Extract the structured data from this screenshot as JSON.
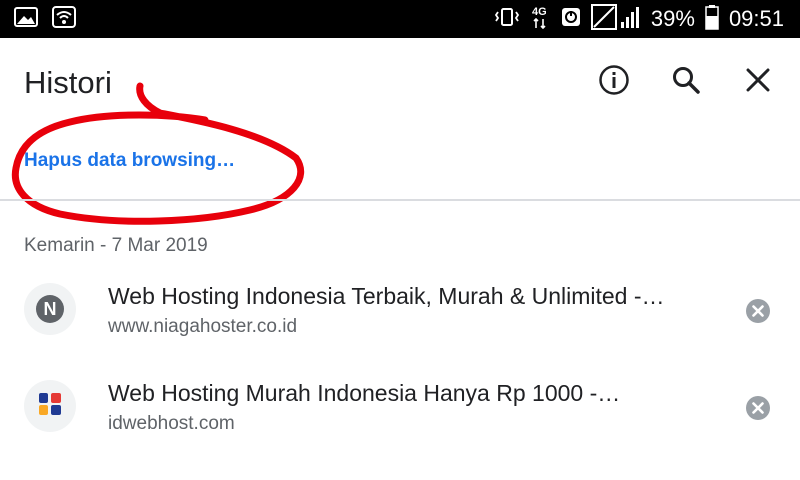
{
  "status_bar": {
    "battery_percent": "39%",
    "time": "09:51",
    "network_label": "4G",
    "icons": [
      "image-icon",
      "wifi-icon",
      "vibrate-icon",
      "network-4g-icon",
      "data-saver-icon",
      "signal-icon",
      "battery-icon"
    ]
  },
  "header": {
    "title": "Histori",
    "actions": [
      "info-icon",
      "search-icon",
      "close-icon"
    ]
  },
  "clear_browsing_label": "Hapus data browsing…",
  "history": {
    "date_header": "Kemarin - 7 Mar 2019",
    "items": [
      {
        "title": "Web Hosting Indonesia Terbaik, Murah & Unlimited -…",
        "url": "www.niagahoster.co.id",
        "favicon_letter": "N"
      },
      {
        "title": "Web Hosting Murah Indonesia Hanya Rp 1000 -…",
        "url": "idwebhost.com",
        "favicon_letter": ""
      }
    ]
  },
  "colors": {
    "link": "#1a73e8",
    "annotation": "#e8000b",
    "text_primary": "#202124",
    "text_secondary": "#5f6368",
    "divider": "#dadce0"
  }
}
